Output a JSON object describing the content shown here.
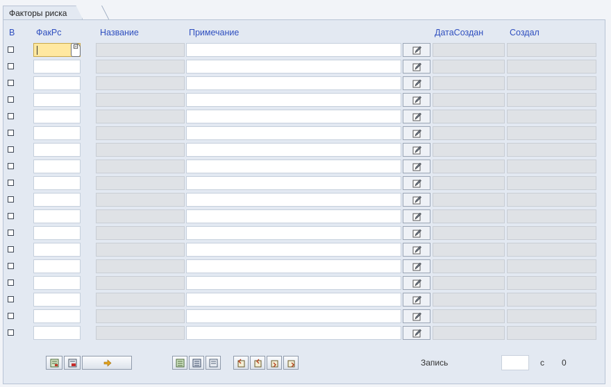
{
  "tab": {
    "label": "Факторы риска"
  },
  "table": {
    "columns": {
      "select": "В",
      "fakrs": "ФакРс",
      "name": "Название",
      "note": "Примечание",
      "date_created": "ДатаСоздан",
      "created_by": "Создал"
    },
    "row_count": 18,
    "active_row": 0,
    "rows": []
  },
  "footer": {
    "record_label": "Запись",
    "record_value": "",
    "of_label": "с",
    "total": "0"
  },
  "icons": {
    "edit_cell": "edit-pencil-icon",
    "value_help": "f4-help-icon",
    "toolbar_group1": [
      "detail-icon",
      "delete-icon",
      "arrow-icon"
    ],
    "toolbar_group2": [
      "select-all-icon",
      "deselect-all-icon",
      "select-block-icon"
    ],
    "toolbar_group3": [
      "page-first-icon",
      "page-prev-icon",
      "page-next-icon",
      "page-last-icon"
    ]
  },
  "colors": {
    "header_text": "#2f4fbf",
    "panel_bg": "#e3e9f2",
    "active_cell": "#ffe8a0",
    "readonly_cell": "#dfe2e6"
  }
}
